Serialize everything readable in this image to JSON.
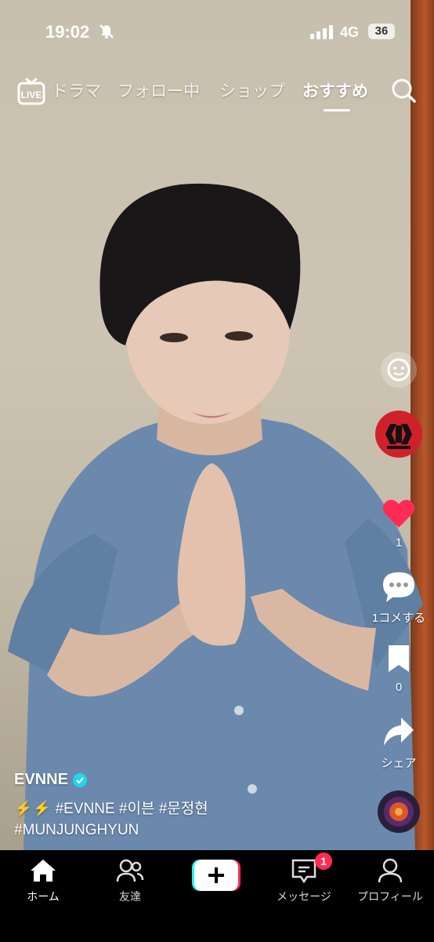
{
  "status_bar": {
    "time": "19:02",
    "network": "4G",
    "battery": "36"
  },
  "top_nav": {
    "tabs": [
      {
        "label": "ドラマ"
      },
      {
        "label": "フォロー中"
      },
      {
        "label": "ショップ"
      },
      {
        "label": "おすすめ",
        "active": true
      }
    ]
  },
  "side_rail": {
    "like_count": "1",
    "comment_label": "1コメする",
    "bookmark_count": "0",
    "share_label": "シェア"
  },
  "caption": {
    "author": "EVNNE",
    "line1": "⚡⚡ #EVNNE #이븐 #문정현",
    "line2": "#MUNJUNGHYUN"
  },
  "bottom_nav": {
    "items": [
      {
        "label": "ホーム",
        "icon": "home-icon"
      },
      {
        "label": "友達",
        "icon": "friends-icon"
      },
      {
        "label": "",
        "icon": "create-plus-icon"
      },
      {
        "label": "メッセージ",
        "icon": "message-icon",
        "badge": "1"
      },
      {
        "label": "プロフィール",
        "icon": "profile-icon"
      }
    ]
  },
  "colors": {
    "accent": "#fe2c55",
    "verified": "#20d5ec",
    "avatar": "#d0212b"
  }
}
